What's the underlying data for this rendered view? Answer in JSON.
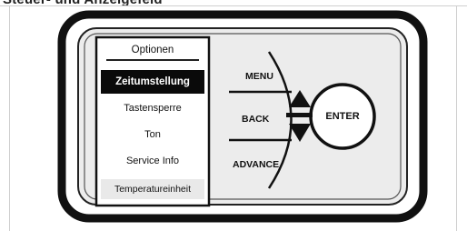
{
  "caption": "Steuer- und Anzeigefeld",
  "menu": {
    "header": "Optionen",
    "items": [
      {
        "label": "Zeitumstellung",
        "selected": true
      },
      {
        "label": "Tastensperre",
        "selected": false
      },
      {
        "label": "Ton",
        "selected": false
      },
      {
        "label": "Service Info",
        "selected": false
      },
      {
        "label": "Temperatureinheit",
        "selected": false
      }
    ]
  },
  "buttons": {
    "menu": "MENU",
    "back": "BACK",
    "advance": "ADVANCE",
    "enter": "ENTER"
  },
  "icons": {
    "up": "triangle-up-icon",
    "down": "triangle-down-icon",
    "separator": "equals-bar-icon"
  },
  "colors": {
    "selected_bg": "#0a0a0a",
    "selected_fg": "#ffffff",
    "frame": "#1a1a1a",
    "panel_fill": "#ececec"
  }
}
